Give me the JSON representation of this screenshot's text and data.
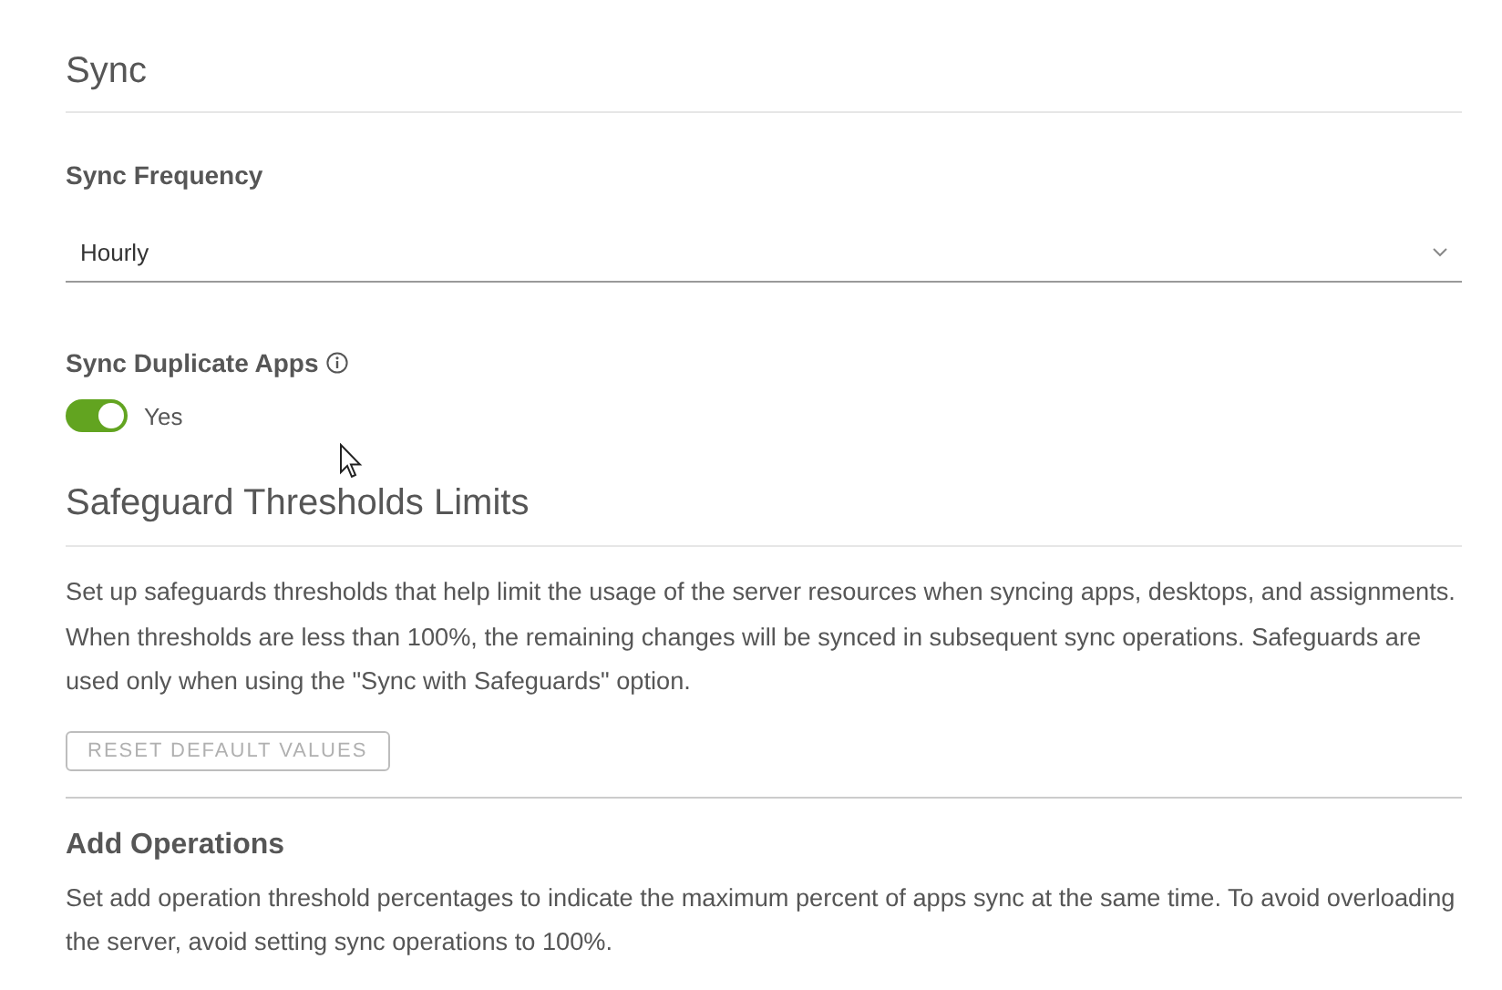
{
  "sync": {
    "title": "Sync",
    "frequency": {
      "label": "Sync Frequency",
      "value": "Hourly"
    },
    "duplicate_apps": {
      "label": "Sync Duplicate Apps",
      "on": true,
      "state_label": "Yes"
    }
  },
  "safeguards": {
    "title": "Safeguard Thresholds Limits",
    "description": "Set up safeguards thresholds that help limit the usage of the server resources when syncing apps, desktops, and assignments. When thresholds are less than 100%, the remaining changes will be synced in subsequent sync operations. Safeguards are used only when using the \"Sync with Safeguards\" option.",
    "reset_button": {
      "label": "RESET DEFAULT VALUES",
      "disabled": true
    }
  },
  "add_operations": {
    "title": "Add Operations",
    "description": "Set add operation threshold percentages to indicate the maximum percent of apps sync at the same time. To avoid overloading the server, avoid setting sync operations to 100%."
  }
}
